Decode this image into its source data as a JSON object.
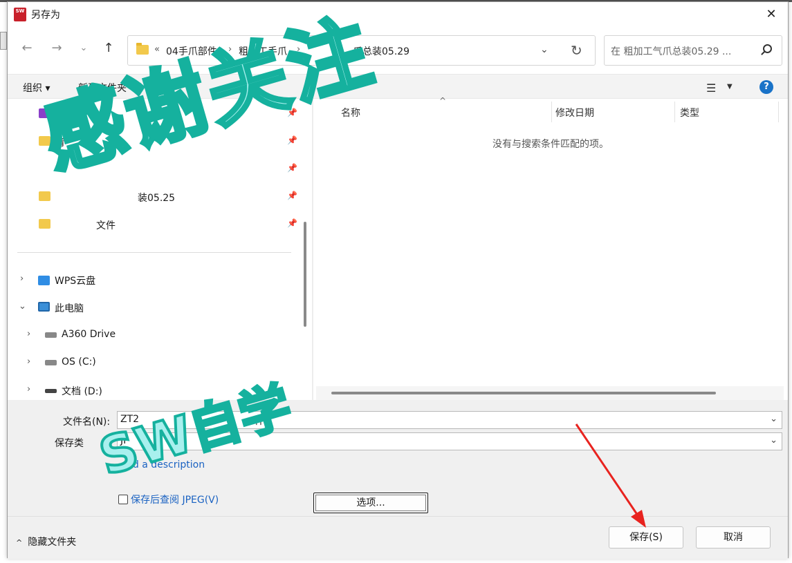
{
  "window": {
    "title": "另存为",
    "app_icon_text": "SW"
  },
  "address": {
    "crumbs": [
      "04手爪部件",
      "粗加工手爪",
      "爪总装05.29"
    ],
    "overflow": "«"
  },
  "search": {
    "placeholder": "在 粗加工气爪总装05.29 ..."
  },
  "toolbar": {
    "organize": "组织 ▾",
    "new_folder": "新建文件夹",
    "help": "?"
  },
  "nav": {
    "quick_items": [
      {
        "label": "视频",
        "icon": "video-icon",
        "pinned": true
      },
      {
        "label": "精",
        "icon": "folder-icon",
        "pinned": true
      },
      {
        "label": "",
        "icon": "folder-icon",
        "pinned": true
      },
      {
        "label": "装05.25",
        "icon": "folder-icon",
        "pinned": true
      },
      {
        "label": "文件",
        "icon": "folder-icon",
        "pinned": true
      }
    ],
    "tree": [
      {
        "label": "WPS云盘",
        "icon": "cloud-icon",
        "expander": "›"
      },
      {
        "label": "此电脑",
        "icon": "pc-icon",
        "expander": "⌄"
      },
      {
        "label": "A360 Drive",
        "icon": "a360-drive-icon",
        "expander": "›"
      },
      {
        "label": "OS (C:)",
        "icon": "drive-icon",
        "expander": "›"
      },
      {
        "label": "文档 (D:)",
        "icon": "disk-icon",
        "expander": "›"
      }
    ]
  },
  "files": {
    "columns": [
      "名称",
      "修改日期",
      "类型"
    ],
    "empty_message": "没有与搜索条件匹配的项。"
  },
  "form": {
    "filename_label": "文件名(N):",
    "filename_value": "ZT2",
    "filename_value_tail": "件",
    "filetype_label": "保存类",
    "filetype_value": "JP",
    "add_description": "dd a description",
    "view_after_save_label": "保存后查阅 JPEG(V)",
    "options_button": "选项..."
  },
  "footer": {
    "hide_folders": "隐藏文件夹",
    "save_button": "保存(S)",
    "cancel_button": "取消"
  },
  "overlay": {
    "watermark_main": "感谢关注",
    "watermark_sub": "SW自学"
  },
  "colors": {
    "accent_link": "#1a62c2",
    "watermark_fill": "#a8f0ee",
    "watermark_stroke": "#15b19e",
    "arrow": "#e8231f"
  }
}
